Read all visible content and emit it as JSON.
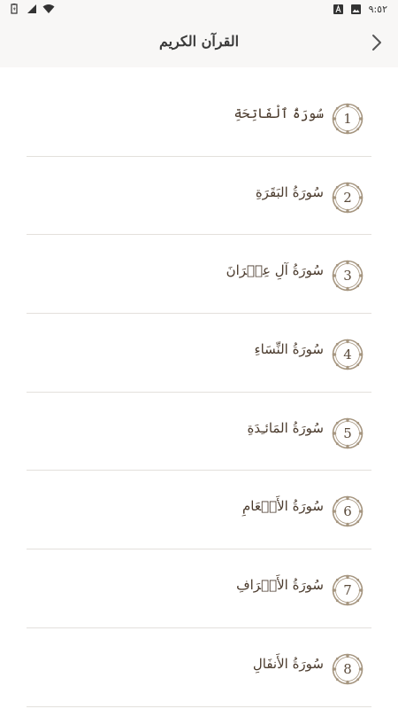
{
  "status_bar": {
    "time": "٩:٥٢"
  },
  "header": {
    "title": "القرآن الكريم"
  },
  "colors": {
    "accent": "#9b8a72",
    "text": "#4a3a2c",
    "divider": "#e3e0dc"
  },
  "surahs": [
    {
      "number": "1",
      "name": "سُورَةُ ٱلْفَاتِحَةِ"
    },
    {
      "number": "2",
      "name": "سُورَةُ البَقَرَةِ"
    },
    {
      "number": "3",
      "name": "سُورَةُ آلِ عِمۡرَانَ"
    },
    {
      "number": "4",
      "name": "سُورَةُ النِّسَاءِ"
    },
    {
      "number": "5",
      "name": "سُورَةُ المَائـِدَةِ"
    },
    {
      "number": "6",
      "name": "سُورَةُ الأَنۡعَامِ"
    },
    {
      "number": "7",
      "name": "سُورَةُ الأَعۡرَافِ"
    },
    {
      "number": "8",
      "name": "سُورَةُ الأَنفَالِ"
    }
  ]
}
